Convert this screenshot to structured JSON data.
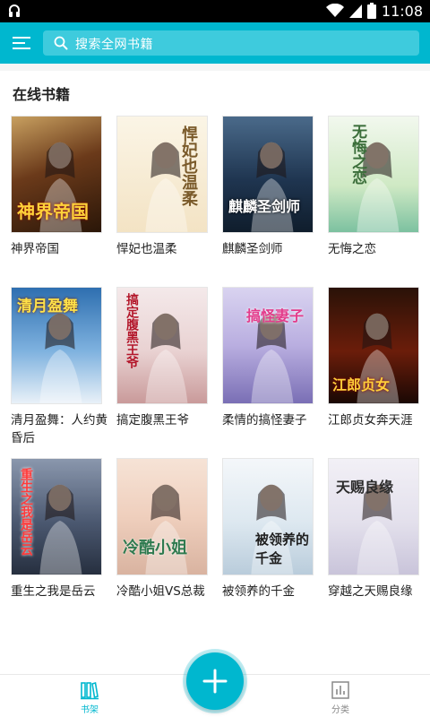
{
  "status_bar": {
    "time": "11:08"
  },
  "search": {
    "placeholder": "搜索全网书籍"
  },
  "section": {
    "title": "在线书籍"
  },
  "books": [
    {
      "title": "神界帝国",
      "cover_text": "神界帝国"
    },
    {
      "title": "悍妃也温柔",
      "cover_text": "悍妃也温柔"
    },
    {
      "title": "麒麟圣剑师",
      "cover_text": "麒麟圣剑师"
    },
    {
      "title": "无悔之恋",
      "cover_text": "无悔之恋"
    },
    {
      "title": "清月盈舞：人约黄昏后",
      "cover_text": "清月盈舞"
    },
    {
      "title": "搞定腹黑王爷",
      "cover_text": "搞定腹黑王爷"
    },
    {
      "title": "柔情的搞怪妻子",
      "cover_text": "搞怪妻子"
    },
    {
      "title": "江郎贞女奔天涯",
      "cover_text": "江郎贞女"
    },
    {
      "title": "重生之我是岳云",
      "cover_text": "重生之我是岳云"
    },
    {
      "title": "冷酷小姐VS总裁",
      "cover_text": "冷酷小姐"
    },
    {
      "title": "被领养的千金",
      "cover_text": "被领养的千金"
    },
    {
      "title": "穿越之天赐良缘",
      "cover_text": "天赐良缘"
    }
  ],
  "bottom_nav": {
    "shelf_label": "书架",
    "category_label": "分类"
  },
  "colors": {
    "accent": "#00b7cf",
    "tab_inactive": "#888888"
  },
  "icons": [
    "menu-icon",
    "search-icon",
    "add-icon",
    "bookshelf-icon",
    "category-icon"
  ]
}
